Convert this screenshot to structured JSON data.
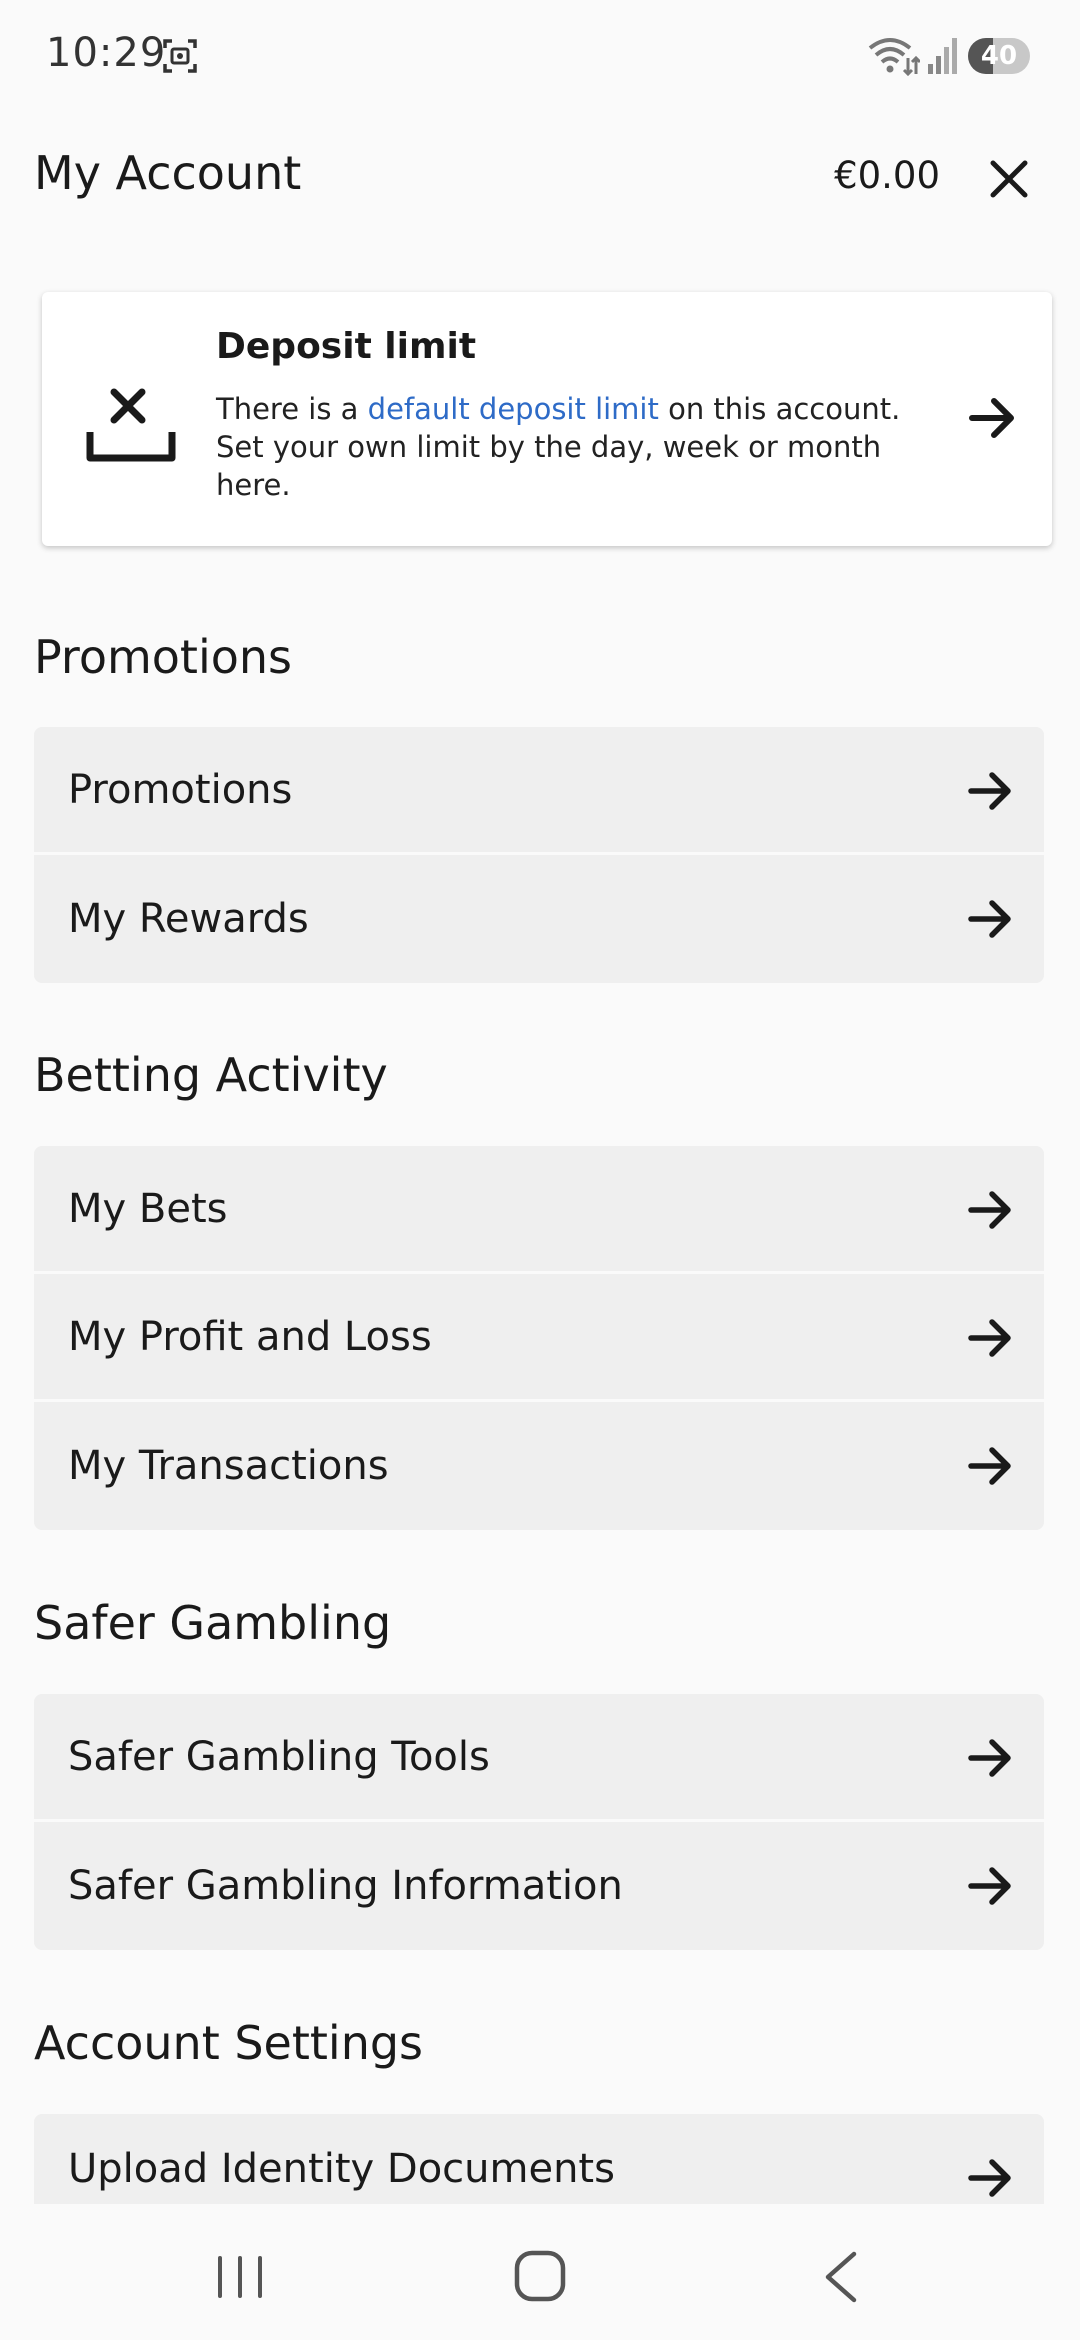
{
  "status": {
    "time": "10:29",
    "battery": "40",
    "battery_level": 0.4
  },
  "header": {
    "title": "My Account",
    "balance": "€0.00"
  },
  "deposit_card": {
    "title": "Deposit limit",
    "text_before": "There is a ",
    "link_text": "default deposit limit",
    "text_after": " on this account. Set your own limit by the day, week or month here."
  },
  "sections": {
    "promotions": {
      "title": "Promotions",
      "items": [
        "Promotions",
        "My Rewards"
      ]
    },
    "betting_activity": {
      "title": "Betting Activity",
      "items": [
        "My Bets",
        "My Profit and Loss",
        "My Transactions"
      ]
    },
    "safer_gambling": {
      "title": "Safer Gambling",
      "items": [
        "Safer Gambling Tools",
        "Safer Gambling Information"
      ]
    },
    "account_settings": {
      "title": "Account Settings",
      "items": [
        "Upload Identity Documents"
      ]
    }
  },
  "colors": {
    "link": "#2e6bc7",
    "menu_bg": "#efefef",
    "page_bg": "#fafafa"
  }
}
